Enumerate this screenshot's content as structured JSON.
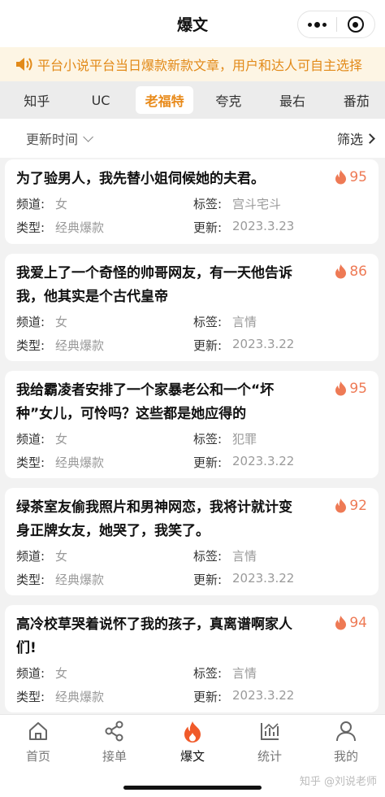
{
  "header": {
    "title": "爆文"
  },
  "notice": {
    "text": "平台小说平台当日爆款新款文章，用户和达人可自主选择"
  },
  "tabs": [
    "知乎",
    "UC",
    "老福特",
    "夸克",
    "最右",
    "番茄"
  ],
  "active_tab": "老福特",
  "filters": {
    "sort_label": "更新时间",
    "filter_label": "筛选"
  },
  "labels": {
    "channel": "频道:",
    "tag": "标签:",
    "type": "类型:",
    "updated": "更新:"
  },
  "cards": [
    {
      "title": "为了验男人，我先替小姐伺候她的夫君。",
      "heat": "95",
      "channel": "女",
      "tag": "宫斗宅斗",
      "type": "经典爆款",
      "updated": "2023.3.23"
    },
    {
      "title": "我爱上了一个奇怪的帅哥网友，有一天他告诉我，他其实是个古代皇帝",
      "heat": "86",
      "channel": "女",
      "tag": "言情",
      "type": "经典爆款",
      "updated": "2023.3.22"
    },
    {
      "title": "我给霸凌者安排了一个家暴老公和一个“坏种”女儿，可怜吗？这些都是她应得的",
      "heat": "95",
      "channel": "女",
      "tag": "犯罪",
      "type": "经典爆款",
      "updated": "2023.3.22"
    },
    {
      "title": "绿茶室友偷我照片和男神网恋，我将计就计变身正牌女友，她哭了，我笑了。",
      "heat": "92",
      "channel": "女",
      "tag": "言情",
      "type": "经典爆款",
      "updated": "2023.3.22"
    },
    {
      "title": "高冷校草哭着说怀了我的孩子，真离谱啊家人们!",
      "heat": "94",
      "channel": "女",
      "tag": "言情",
      "type": "经典爆款",
      "updated": "2023.3.22"
    }
  ],
  "bottom_nav": [
    {
      "label": "首页",
      "icon": "home-icon"
    },
    {
      "label": "接单",
      "icon": "share-icon"
    },
    {
      "label": "爆文",
      "icon": "flame-icon"
    },
    {
      "label": "统计",
      "icon": "chart-icon"
    },
    {
      "label": "我的",
      "icon": "user-icon"
    }
  ],
  "watermark": "知乎 @刘说老师",
  "colors": {
    "accent": "#e88a1a",
    "heat": "#ee7a55",
    "flame_active": "#f05a2a",
    "notice_bg": "#fdf5e4"
  }
}
